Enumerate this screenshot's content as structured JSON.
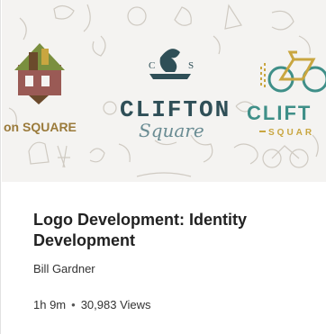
{
  "thumbnail": {
    "logo_left_text": "on SQUARE",
    "logo_center_top": "C",
    "logo_center_top_right": "S",
    "logo_center_main": "CLIFTON",
    "logo_center_script": "Square",
    "logo_right_main": "CLIFT",
    "logo_right_sub": "SQUAR",
    "colors": {
      "background": "#f4f3f1",
      "sketch": "#c9c4bc",
      "center_logo": "#2f4f57",
      "right_logo_teal": "#3f8f88",
      "right_logo_gold": "#c9a640",
      "left_logo_green": "#7a8f3f",
      "left_logo_brown": "#6b4a2c",
      "left_logo_red": "#9a5a55",
      "left_text": "#9a7a3a"
    }
  },
  "course": {
    "title": "Logo Development: Identity Development",
    "author": "Bill Gardner",
    "duration": "1h 9m",
    "separator": "•",
    "views": "30,983 Views"
  }
}
